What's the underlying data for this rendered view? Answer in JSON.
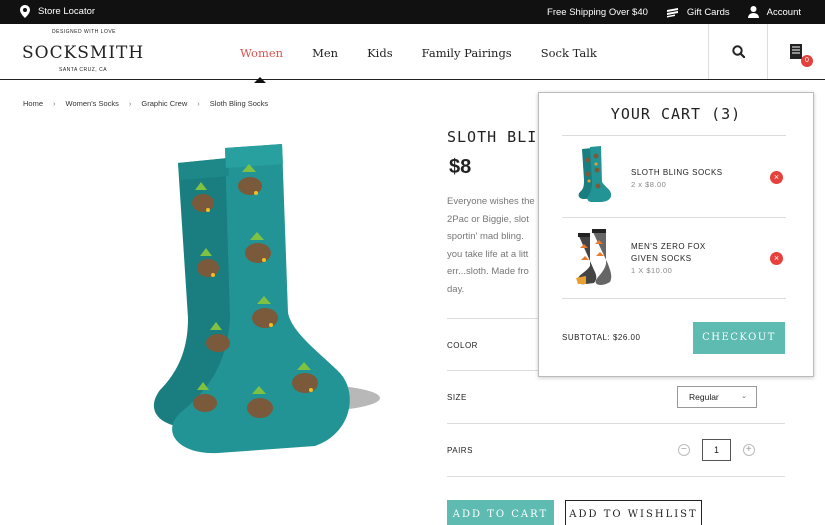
{
  "topbar": {
    "store_locator": "Store Locator",
    "shipping": "Free Shipping Over $40",
    "gift_cards": "Gift Cards",
    "account": "Account"
  },
  "logo": {
    "top_tag": "DESIGNED WITH LOVE",
    "wordmark": "SOCKSMITH",
    "bottom_tag": "SANTA CRUZ, CA"
  },
  "nav": [
    "Women",
    "Men",
    "Kids",
    "Family Pairings",
    "Sock Talk"
  ],
  "nav_active": "Women",
  "header": {
    "cart_count": "0"
  },
  "breadcrumb": [
    "Home",
    "Women's Socks",
    "Graphic Crew",
    "Sloth Bling Socks"
  ],
  "breadcrumb_separator": "›",
  "product": {
    "title": "SLOTH BLI",
    "price": "$8",
    "description_lines": [
      "Everyone wishes the",
      "2Pac or Biggie, slot",
      "sportin' mad bling.",
      "you take life at a litt",
      "err...sloth. Made fro",
      "day."
    ],
    "color_label": "COLOR",
    "size_label": "SIZE",
    "size_value": "Regular",
    "pairs_label": "PAIRS",
    "pairs_value": "1",
    "add_to_cart": "ADD TO CART",
    "add_to_wishlist": "ADD TO WISHLIST"
  },
  "cart": {
    "title": "YOUR CART (3)",
    "items": [
      {
        "name_line1": "SLOTH BLING SOCKS",
        "name_line2": "",
        "qty_price": "2 x $8.00"
      },
      {
        "name_line1": "MEN'S ZERO FOX",
        "name_line2": "GIVEN SOCKS",
        "qty_price": "1 X $10.00"
      }
    ],
    "subtotal": "SUBTOTAL: $26.00",
    "checkout": "CHECKOUT"
  },
  "colors": {
    "accent_teal": "#5dbbb2",
    "active_nav": "#d9534f",
    "remove_red": "#e8403b",
    "sock_teal": "#1f8b8a"
  },
  "icons": {
    "location": "map-pin-icon",
    "gift": "gift-card-icon",
    "account": "user-icon",
    "search": "search-icon",
    "cart": "cart-icon",
    "remove": "close-icon"
  }
}
